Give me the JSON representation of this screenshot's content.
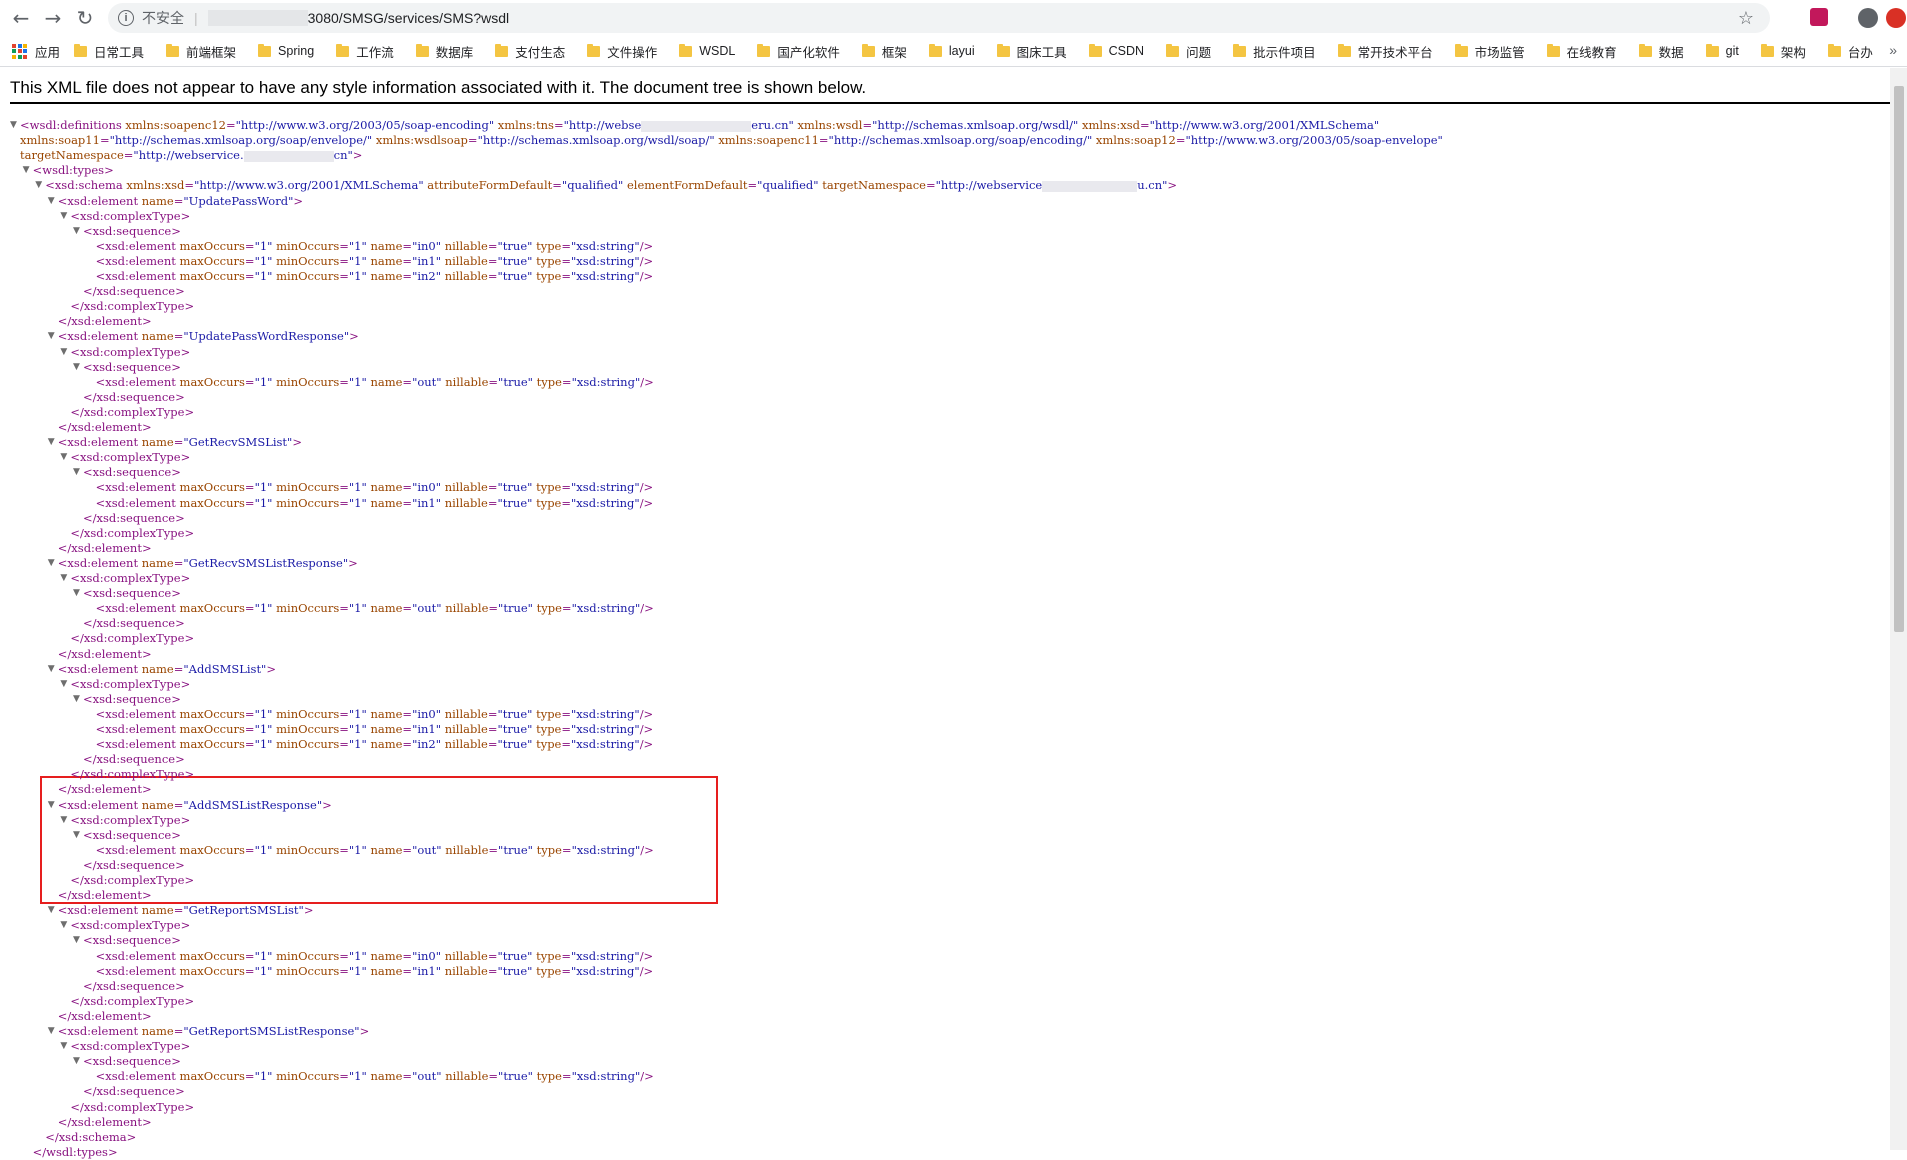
{
  "browser": {
    "nav": {
      "back_icon": "arrow-left-icon",
      "forward_icon": "arrow-right-icon",
      "reload_icon": "reload-icon"
    },
    "address": {
      "security_label": "不安全",
      "separator": "|",
      "url_tail": "3080/SMSG/services/SMS?wsdl"
    },
    "bookmarks_apps": "应用",
    "bookmarks": [
      "日常工具",
      "前端框架",
      "Spring",
      "工作流",
      "数据库",
      "支付生态",
      "文件操作",
      "WSDL",
      "国产化软件",
      "框架",
      "layui",
      "图床工具",
      "CSDN",
      "问题",
      "批示件项目",
      "常开技术平台",
      "市场监管",
      "在线教育",
      "数据",
      "git",
      "架构",
      "台办"
    ],
    "more_label": "»"
  },
  "xml": {
    "header": "This XML file does not appear to have any style information associated with it. The document tree is shown below.",
    "definitions": {
      "soapenc12": "http://www.w3.org/2003/05/soap-encoding",
      "tns_start": "http://webse",
      "tns_end": "eru.cn",
      "wsdl": "http://schemas.xmlsoap.org/wsdl/",
      "xsd": "http://www.w3.org/2001/XMLSchema",
      "soap11": "http://schemas.xmlsoap.org/soap/envelope/",
      "wsdlsoap": "http://schemas.xmlsoap.org/wsdl/soap/",
      "soapenc11": "http://schemas.xmlsoap.org/soap/encoding/",
      "soap12": "http://www.w3.org/2003/05/soap-envelope",
      "targetNamespace_start": "http://webservice.",
      "targetNamespace_end": "cn"
    },
    "schema": {
      "xsd": "http://www.w3.org/2001/XMLSchema",
      "attributeFormDefault": "qualified",
      "elementFormDefault": "qualified",
      "targetNamespace_start": "http://webservice",
      "targetNamespace_end": "u.cn"
    },
    "elements": [
      {
        "name": "UpdatePassWord",
        "fields": [
          "in0",
          "in1",
          "in2"
        ]
      },
      {
        "name": "UpdatePassWordResponse",
        "fields": [
          "out"
        ]
      },
      {
        "name": "GetRecvSMSList",
        "fields": [
          "in0",
          "in1"
        ]
      },
      {
        "name": "GetRecvSMSListResponse",
        "fields": [
          "out"
        ]
      },
      {
        "name": "AddSMSList",
        "fields": [
          "in0",
          "in1",
          "in2"
        ]
      },
      {
        "name": "AddSMSListResponse",
        "fields": [
          "out"
        ]
      },
      {
        "name": "GetReportSMSList",
        "fields": [
          "in0",
          "in1"
        ]
      },
      {
        "name": "GetReportSMSListResponse",
        "fields": [
          "out"
        ]
      }
    ],
    "field_attrs": {
      "maxOccurs": "1",
      "minOccurs": "1",
      "nillable": "true",
      "type": "xsd:string"
    },
    "highlighted_element": "AddSMSList"
  }
}
